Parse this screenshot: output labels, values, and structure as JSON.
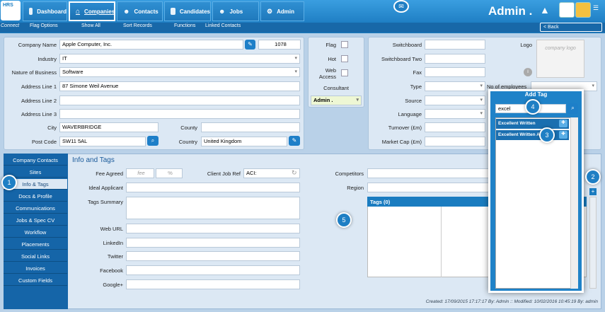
{
  "app": {
    "logo_text": "HRS",
    "connect": "Connect",
    "user": "Admin ."
  },
  "nav": [
    "Dashboard",
    "Companies",
    "Contacts",
    "Candidates",
    "Jobs",
    "Admin"
  ],
  "subnav": [
    "Flag Options",
    "Show All",
    "Sort Records",
    "Functions",
    "Linked Contacts"
  ],
  "back": "< Back",
  "company": {
    "labels": {
      "name": "Company Name",
      "industry": "Industry",
      "nature": "Nature of Business",
      "addr1": "Address Line 1",
      "addr2": "Address Line 2",
      "addr3": "Address Line 3",
      "city": "City",
      "county": "County",
      "postcode": "Post Code",
      "country": "Country"
    },
    "name": "Apple Computer, Inc.",
    "id": "1078",
    "industry": "IT",
    "nature": "Software",
    "addr1": "87 Simone Weil Avenue",
    "addr2": "",
    "addr3": "",
    "city": "WAVERBRIDGE",
    "county": "",
    "postcode": "SW11 5AL",
    "country": "United Kingdom"
  },
  "flags": {
    "flag": "Flag",
    "hot": "Hot",
    "web_access": "Web Access",
    "consultant": "Consultant",
    "consultant_value": "Admin ."
  },
  "contact": {
    "switchboard": "Switchboard",
    "switchboard2": "Switchboard Two",
    "fax": "Fax",
    "type": "Type",
    "source": "Source",
    "language": "Language",
    "turnover": "Turnover (£m)",
    "marketcap": "Market Cap (£m)",
    "logo": "Logo",
    "logo_placeholder": "company logo",
    "employees": "No of employees"
  },
  "sidetabs": [
    "Company Contacts",
    "Sites",
    "Info & Tags",
    "Docs & Profile",
    "Communications",
    "Jobs & Spec CV",
    "Workflow",
    "Placements",
    "Social Links",
    "Invoices",
    "Custom Fields"
  ],
  "info": {
    "title": "Info and Tags",
    "fee_agreed": "Fee Agreed",
    "fee_placeholder": "fee",
    "pct": "%",
    "client_job_ref": "Client Job Ref",
    "client_job_ref_value": "ACI:",
    "ideal_applicant": "Ideal Applicant",
    "tags_summary": "Tags Summary",
    "web_url": "Web URL",
    "linkedin": "LinkedIn",
    "twitter": "Twitter",
    "facebook": "Facebook",
    "googleplus": "Google+",
    "competitors": "Competitors",
    "region": "Region",
    "tags_header": "Tags (0)"
  },
  "footer": "Created: 17/09/2015 17:17:17 By: Admin :: Modified: 10/02/2016 10:45:19 By: admin",
  "addtag": {
    "title": "Add Tag",
    "search": "excel",
    "results": [
      "Excellent Written",
      "Excellent Written Arabic"
    ]
  },
  "badges": [
    "1",
    "2",
    "3",
    "4",
    "5"
  ]
}
